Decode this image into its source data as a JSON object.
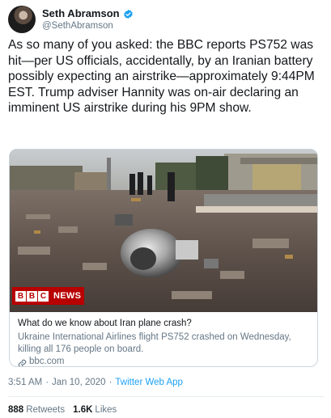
{
  "user": {
    "display_name": "Seth Abramson",
    "handle": "@SethAbramson",
    "verified": true
  },
  "tweet": {
    "text": "As so many of you asked: the BBC reports PS752 was hit—per US officials, accidentally, by an Iranian battery possibly expecting an airstrike—approximately 9:44PM EST. Trump adviser Hannity was on-air declaring an imminent US airstrike during his 9PM show."
  },
  "card": {
    "badge_letters": [
      "B",
      "B",
      "C"
    ],
    "badge_label": "NEWS",
    "title": "What do we know about Iran plane crash?",
    "description": "Ukraine International Airlines flight PS752 crashed on Wednesday, killing all 176 people on board.",
    "domain": "bbc.com"
  },
  "meta": {
    "time": "3:51 AM",
    "separator1": "·",
    "date": "Jan 10, 2020",
    "separator2": "·",
    "app": "Twitter Web App"
  },
  "stats": {
    "retweets_value": "888",
    "retweets_label": "Retweets",
    "likes_value": "1.6K",
    "likes_label": "Likes"
  },
  "colors": {
    "text": "#14171a",
    "secondary": "#657786",
    "link": "#1da1f2",
    "bbc_red": "#b80000",
    "border": "#ccd6dd"
  },
  "icons": {
    "verified": "verified-badge-icon",
    "link": "link-icon"
  }
}
